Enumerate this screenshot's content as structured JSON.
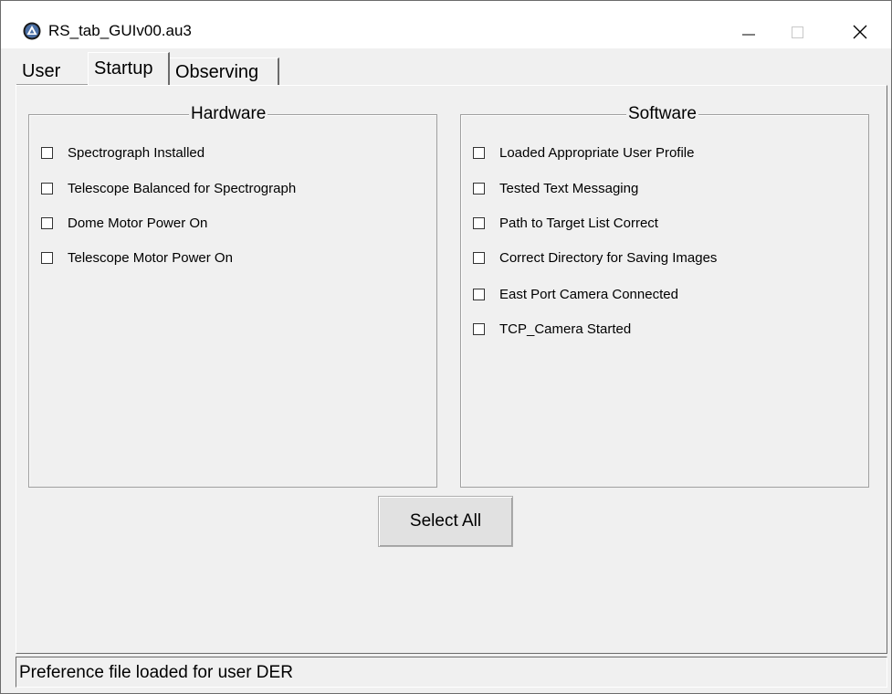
{
  "window": {
    "title": "RS_tab_GUIv00.au3",
    "icon": "autoit-icon",
    "controls": [
      "minimize-icon",
      "maximize-icon",
      "close-icon"
    ]
  },
  "tabs": [
    {
      "label": "User",
      "selected": false
    },
    {
      "label": "Startup",
      "selected": true
    },
    {
      "label": "Observing",
      "selected": false
    }
  ],
  "hardware": {
    "legend": "Hardware",
    "items": [
      {
        "label": "Spectrograph Installed",
        "checked": false
      },
      {
        "label": "Telescope Balanced for Spectrograph",
        "checked": false
      },
      {
        "label": "Dome Motor Power On",
        "checked": false
      },
      {
        "label": "Telescope Motor Power On",
        "checked": false
      }
    ]
  },
  "software": {
    "legend": "Software",
    "items": [
      {
        "label": "Loaded Appropriate User Profile",
        "checked": false
      },
      {
        "label": "Tested Text Messaging",
        "checked": false
      },
      {
        "label": "Path to Target List Correct",
        "checked": false
      },
      {
        "label": "Correct Directory for Saving Images",
        "checked": false
      },
      {
        "label": "East Port Camera Connected",
        "checked": false
      },
      {
        "label": "TCP_Camera Started",
        "checked": false
      }
    ]
  },
  "buttons": {
    "select_all": "Select All"
  },
  "status": {
    "text": "Preference file loaded for user DER"
  }
}
